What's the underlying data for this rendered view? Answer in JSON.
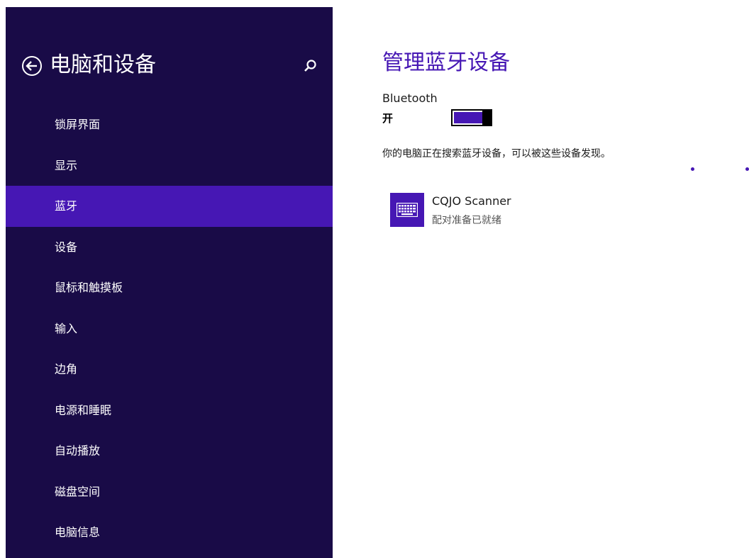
{
  "sidebar": {
    "title": "电脑和设备",
    "items": [
      {
        "label": "锁屏界面",
        "selected": false
      },
      {
        "label": "显示",
        "selected": false
      },
      {
        "label": "蓝牙",
        "selected": true
      },
      {
        "label": "设备",
        "selected": false
      },
      {
        "label": "鼠标和触摸板",
        "selected": false
      },
      {
        "label": "输入",
        "selected": false
      },
      {
        "label": "边角",
        "selected": false
      },
      {
        "label": "电源和睡眠",
        "selected": false
      },
      {
        "label": "自动播放",
        "selected": false
      },
      {
        "label": "磁盘空间",
        "selected": false
      },
      {
        "label": "电脑信息",
        "selected": false
      }
    ]
  },
  "main": {
    "title": "管理蓝牙设备",
    "bluetooth": {
      "label": "Bluetooth",
      "state": "开",
      "on": true
    },
    "status": "你的电脑正在搜索蓝牙设备，可以被这些设备发现。",
    "devices": [
      {
        "name": "CQJO Scanner",
        "status": "配对准备已就绪",
        "icon": "keyboard-icon"
      }
    ]
  },
  "icons": {
    "back": "back-arrow-icon",
    "search": "search-icon"
  },
  "colors": {
    "sidebar_bg": "#190b47",
    "accent": "#4617b4",
    "selected_bg": "#4617b4"
  }
}
